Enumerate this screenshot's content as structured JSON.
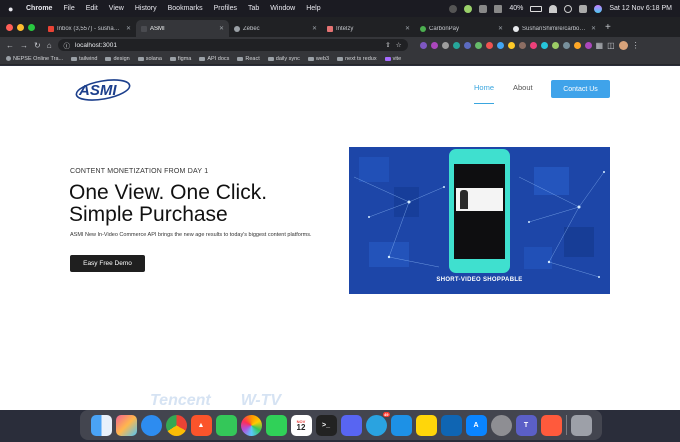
{
  "menubar": {
    "app_name": "Chrome",
    "items": [
      "File",
      "Edit",
      "View",
      "History",
      "Bookmarks",
      "Profiles",
      "Tab",
      "Window",
      "Help"
    ],
    "battery": "40%",
    "clock": "Sat 12 Nov  6:18 PM"
  },
  "tabs": [
    {
      "label": "Inbox (3,557) - sushangm",
      "favicon_color": "#ea4335",
      "active": false
    },
    {
      "label": "ASMI",
      "favicon_color": "#35363a",
      "active": true
    },
    {
      "label": "Zebec",
      "favicon_color": "#9aa0a6",
      "active": false
    },
    {
      "label": "Intelzy",
      "favicon_color": "#e57373",
      "active": false
    },
    {
      "label": "CarbonPay",
      "favicon_color": "#4caf50",
      "active": false
    },
    {
      "label": "SushanShimire/carbonPa",
      "favicon_color": "#e8eaed",
      "active": false
    }
  ],
  "toolbar": {
    "url": "localhost:3001"
  },
  "bookmarks": [
    "NEPSE Online Tra...",
    "tailwind",
    "design",
    "solana",
    "figma",
    "API docs",
    "React",
    "daily sync",
    "web3",
    "next ts redux",
    "vite"
  ],
  "page": {
    "logo_text": "ASMI",
    "nav": {
      "home": "Home",
      "about": "About",
      "contact": "Contact Us"
    },
    "eyebrow": "CONTENT MONETIZATION FROM DAY 1",
    "headline_line1": "One View. One Click.",
    "headline_line2": "Simple Purchase",
    "subtext": "ASMI New In-Video Commerce API brings the new age results to today's biggest content platforms.",
    "cta": "Easy Free Demo",
    "hero_caption": "SHORT-VIDEO SHOPPABLE",
    "partner_text": [
      "Tencent",
      "W-TV"
    ]
  },
  "dock": {
    "calendar_month": "NOV",
    "calendar_day": "12",
    "badge": "49"
  },
  "colors": {
    "accent": "#3fa3ea",
    "hero_bg": "#1d46a8",
    "phone": "#3fe0cf"
  }
}
